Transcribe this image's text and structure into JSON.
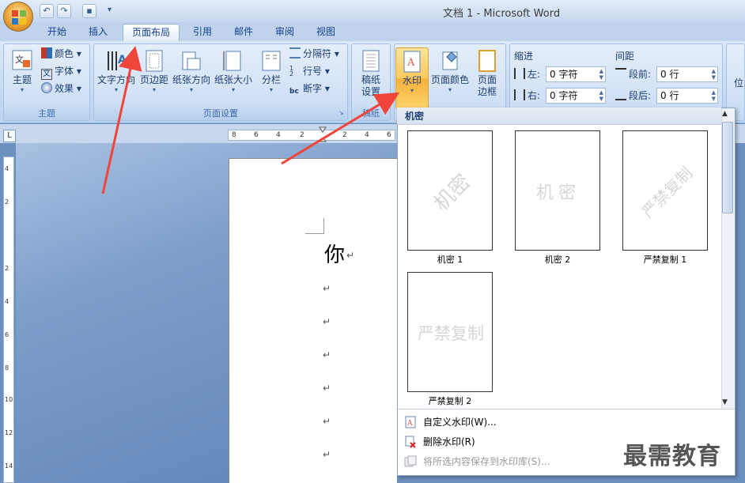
{
  "window": {
    "title": "文档 1 - Microsoft Word"
  },
  "tabs": [
    {
      "label": "开始"
    },
    {
      "label": "插入"
    },
    {
      "label": "页面布局",
      "active": true
    },
    {
      "label": "引用"
    },
    {
      "label": "邮件"
    },
    {
      "label": "审阅"
    },
    {
      "label": "视图"
    }
  ],
  "ribbon": {
    "theme_group": {
      "label": "主题",
      "theme_btn": "主题",
      "colors": "颜色",
      "fonts": "字体",
      "effects": "效果"
    },
    "page_setup_group": {
      "label": "页面设置",
      "text_direction": "文字方向",
      "margins": "页边距",
      "orientation": "纸张方向",
      "size": "纸张大小",
      "columns": "分栏",
      "breaks": "分隔符",
      "line_numbers": "行号",
      "hyphenation": "断字"
    },
    "draft_group": {
      "label": "稿纸",
      "draft_btn_l1": "稿纸",
      "draft_btn_l2": "设置"
    },
    "bg_group": {
      "watermark": "水印",
      "page_color": "页面颜色",
      "page_border_l1": "页面",
      "page_border_l2": "边框"
    },
    "indent": {
      "title": "缩进",
      "left_label": "左:",
      "left_value": "0 字符",
      "right_label": "右:",
      "right_value": "0 字符"
    },
    "spacing": {
      "title": "间距",
      "before_label": "段前:",
      "before_value": "0 行",
      "after_label": "段后:",
      "after_value": "0 行"
    },
    "position_label": "位"
  },
  "ruler": {
    "numbers": [
      "8",
      "6",
      "4",
      "2",
      "2",
      "4",
      "6"
    ],
    "vnumbers": [
      "4",
      "2",
      "2",
      "4",
      "6",
      "8",
      "10",
      "12",
      "14"
    ]
  },
  "document": {
    "text": "你",
    "para_mark": "↵"
  },
  "gallery": {
    "header": "机密",
    "items": [
      {
        "label": "机密 1",
        "watermark": "机密",
        "diagonal": true
      },
      {
        "label": "机密 2",
        "watermark": "机密",
        "diagonal": false
      },
      {
        "label": "严禁复制 1",
        "watermark": "严禁复制",
        "diagonal": true
      },
      {
        "label": "严禁复制 2",
        "watermark": "严禁复制",
        "diagonal": false
      }
    ],
    "menu": [
      {
        "label": "自定义水印(W)...",
        "disabled": false
      },
      {
        "label": "删除水印(R)",
        "disabled": false
      },
      {
        "label": "将所选内容保存到水印库(S)...",
        "disabled": true
      }
    ]
  },
  "overlay_logo": "最需教育",
  "colors": {
    "accent_arrow": "#f0453a",
    "ribbon_bg": "#c4d9f1",
    "highlight": "#fbc95e"
  }
}
